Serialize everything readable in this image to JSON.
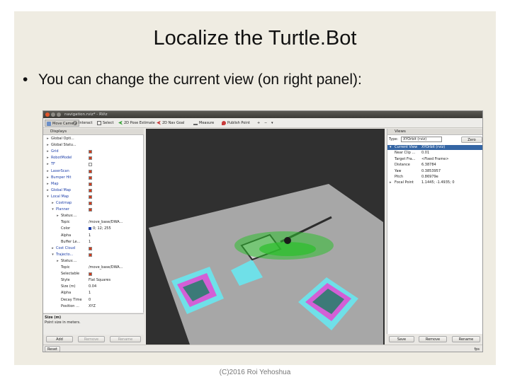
{
  "slide": {
    "title": "Localize the Turtle.Bot",
    "bullet": "You can change the current view (on right panel):",
    "footer": "(C)2016 Roi Yehoshua"
  },
  "window": {
    "title": "navigation.rviz* - RViz"
  },
  "toolbar": {
    "tools": [
      {
        "label": "Move Camera",
        "icon": "move-camera-icon",
        "active": true
      },
      {
        "label": "Interact",
        "icon": "interact-icon"
      },
      {
        "label": "Select",
        "icon": "select-icon"
      },
      {
        "label": "2D Pose Estimate",
        "icon": "pose-estimate-icon"
      },
      {
        "label": "2D Nav Goal",
        "icon": "nav-goal-icon"
      },
      {
        "label": "Measure",
        "icon": "measure-icon"
      },
      {
        "label": "Publish Point",
        "icon": "publish-point-icon"
      }
    ]
  },
  "displays": {
    "header": "Displays",
    "rows": [
      {
        "label": "Global Opti...",
        "depth": 0,
        "arrow": "▸",
        "blue": false
      },
      {
        "label": "Global Statu...",
        "depth": 0,
        "arrow": "▸",
        "blue": false
      },
      {
        "label": "Grid",
        "depth": 0,
        "arrow": "▸",
        "blue": true,
        "check": true
      },
      {
        "label": "RobotModel",
        "depth": 0,
        "arrow": "▸",
        "blue": true,
        "check": true
      },
      {
        "label": "TF",
        "depth": 0,
        "arrow": "▸",
        "blue": true,
        "check": false
      },
      {
        "label": "LaserScan",
        "depth": 0,
        "arrow": "▸",
        "blue": true,
        "check": true
      },
      {
        "label": "Bumper Hit",
        "depth": 0,
        "arrow": "▸",
        "blue": true,
        "check": true
      },
      {
        "label": "Map",
        "depth": 0,
        "arrow": "▸",
        "blue": true,
        "check": true
      },
      {
        "label": "Global Map",
        "depth": 0,
        "arrow": "▸",
        "blue": true,
        "check": true
      },
      {
        "label": "Local Map",
        "depth": 0,
        "arrow": "▾",
        "blue": true,
        "check": true
      },
      {
        "label": "Costmap",
        "depth": 1,
        "arrow": "▸",
        "blue": true,
        "check": true
      },
      {
        "label": "Planner",
        "depth": 1,
        "arrow": "▾",
        "blue": true,
        "check": true
      },
      {
        "label": "Status:...",
        "depth": 2,
        "arrow": "▸",
        "blue": false
      },
      {
        "label": "Topic",
        "depth": 2,
        "value": "/move_base/DWA..."
      },
      {
        "label": "Color",
        "depth": 2,
        "value": "0; 12; 255",
        "swatch": true
      },
      {
        "label": "Alpha",
        "depth": 2,
        "value": "1"
      },
      {
        "label": "Buffer Le...",
        "depth": 2,
        "value": "1"
      },
      {
        "label": "Cost Cloud",
        "depth": 1,
        "arrow": "▸",
        "blue": true,
        "check": true
      },
      {
        "label": "Trajecto...",
        "depth": 1,
        "arrow": "▾",
        "blue": true,
        "check": true
      },
      {
        "label": "Status:...",
        "depth": 2,
        "arrow": "▸",
        "blue": false
      },
      {
        "label": "Topic",
        "depth": 2,
        "value": "/move_base/DWA..."
      },
      {
        "label": "Selectable",
        "depth": 2,
        "check": true
      },
      {
        "label": "Style",
        "depth": 2,
        "value": "Flat Squares"
      },
      {
        "label": "Size (m)",
        "depth": 2,
        "value": "0.04"
      },
      {
        "label": "Alpha",
        "depth": 2,
        "value": "1"
      },
      {
        "label": "Decay Time",
        "depth": 2,
        "value": "0"
      },
      {
        "label": "Position ...",
        "depth": 2,
        "value": "XYZ"
      }
    ],
    "description_title": "Size (m)",
    "description_text": "Point size in meters.",
    "add_label": "Add",
    "remove_label": "Remove",
    "rename_label": "Rename"
  },
  "views": {
    "header": "Views",
    "type_label": "Type:",
    "type_value": "XYOrbit (rviz)",
    "zero_label": "Zero",
    "rows": [
      {
        "label": "Current View",
        "value": "XYOrbit (rviz)",
        "arrow": "▾",
        "selected": true
      },
      {
        "label": "Near Clip ...",
        "value": "0.01"
      },
      {
        "label": "Target Fra...",
        "value": "<Fixed Frame>"
      },
      {
        "label": "Distance",
        "value": "6.38784"
      },
      {
        "label": "Yaw",
        "value": "0.3853957"
      },
      {
        "label": "Pitch",
        "value": "0.86979e"
      },
      {
        "label": "Focal Point",
        "value": "1.1445; -1.4935; 0",
        "arrow": "▸"
      }
    ],
    "save_label": "Save",
    "remove_label": "Remove",
    "rename_label": "Rename"
  },
  "status": {
    "reset_label": "Reset",
    "fps": "fps"
  },
  "colors": {
    "selection": "#3465a4",
    "check": "#d23b1b",
    "viewport_bg": "#303030",
    "map_floor": "#a7a7a7",
    "costmap_cyan": "#6fe0e8",
    "costmap_magenta": "#d35fd6",
    "path_green": "#2fbf2f"
  }
}
